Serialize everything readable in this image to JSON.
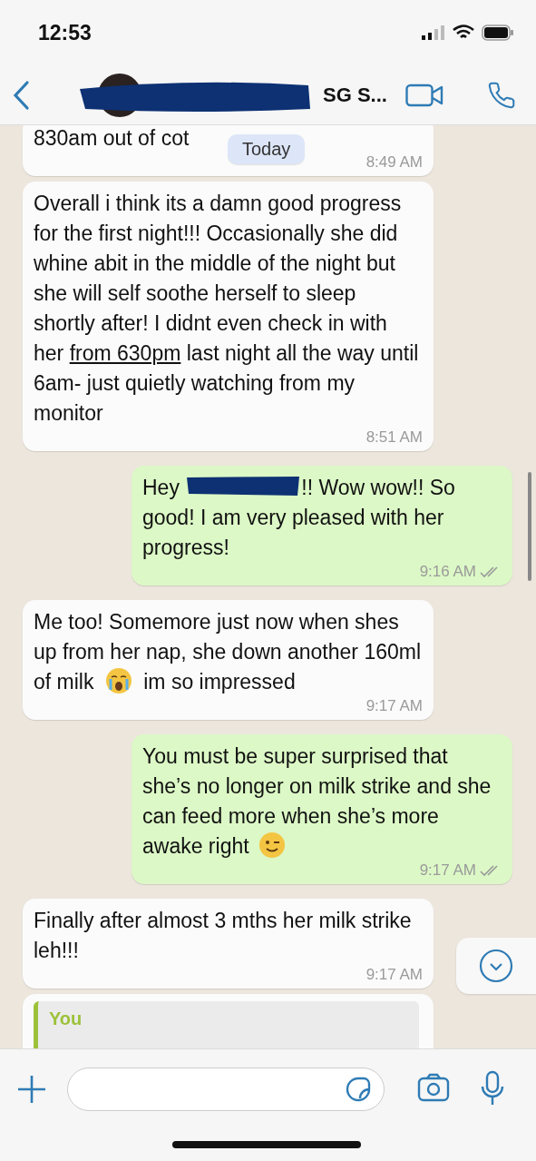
{
  "status_bar": {
    "time": "12:53"
  },
  "header": {
    "title": "SG S..."
  },
  "date_chip": "Today",
  "messages": [
    {
      "kind": "incoming",
      "parts": [
        {
          "kind": "text",
          "text": "830am out of cot"
        }
      ],
      "time": "8:49 AM"
    },
    {
      "kind": "incoming",
      "parts": [
        {
          "kind": "text",
          "text": "Overall i think its a damn good progress for the first night!!! Occasionally she did whine abit in the middle of the night but she will self soothe herself to sleep shortly after! I didnt even check in with her "
        },
        {
          "kind": "link",
          "text": "from 630pm"
        },
        {
          "kind": "text",
          "text": " last night all the way until 6am- just quietly watching from my monitor"
        }
      ],
      "time": "8:51 AM"
    },
    {
      "kind": "outgoing",
      "parts": [
        {
          "kind": "text",
          "text": "Hey "
        },
        {
          "kind": "redaction"
        },
        {
          "kind": "text",
          "text": "!! Wow wow!! So good! I am very pleased with her progress!"
        }
      ],
      "time": "9:16 AM",
      "read": false
    },
    {
      "kind": "incoming",
      "parts": [
        {
          "kind": "text",
          "text": "Me too! Somemore just now when shes up from her nap, she down another 160ml of milk "
        },
        {
          "kind": "crying_face"
        },
        {
          "kind": "text",
          "text": " im so impressed"
        }
      ],
      "time": "9:17 AM"
    },
    {
      "kind": "outgoing",
      "parts": [
        {
          "kind": "text",
          "text": "You must be super surprised that she’s no longer on milk strike and she can feed more when she’s more awake right "
        },
        {
          "kind": "winking_face"
        }
      ],
      "time": "9:17 AM",
      "read": false
    },
    {
      "kind": "incoming",
      "parts": [
        {
          "kind": "text",
          "text": "Finally after almost 3 mths her milk strike leh!!!"
        }
      ],
      "time": "9:17 AM"
    },
    {
      "kind": "incoming",
      "quote": {
        "author": "You"
      }
    }
  ]
}
